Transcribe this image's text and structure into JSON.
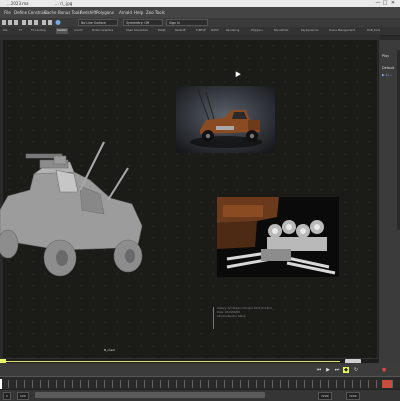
{
  "window": {
    "app_title": "...2023.ma",
    "file_name": "... rl_.jpg",
    "minimize_glyph": "—",
    "maximize_glyph": "□",
    "close_glyph": "✕"
  },
  "menubar": {
    "items": [
      "File",
      "Define",
      "Constrain",
      "Cache",
      "Bonus Tools",
      "Redshift",
      "Polygons",
      "Arnold",
      "Help",
      "Zoo Tools"
    ]
  },
  "toolbar": {
    "live_surface": "No Live Surface",
    "symmetry": "Symmetry: Off",
    "sign_in": "Sign In"
  },
  "shelf": {
    "tabs": [
      "File",
      "FX",
      "FX Caching",
      "Custom",
      "Arnold",
      "Motion Graphics",
      "XGen Interactive",
      "Bullet",
      "Redshift",
      "TURTLE",
      "MASH",
      "Rendering",
      "Polygons",
      "BonusTools",
      "KeyDynamics",
      "Scene Management",
      "DAB_tools"
    ],
    "active_index": 3
  },
  "right_panel": {
    "title": "Play",
    "layer": "Default",
    "item": "▶ Li..."
  },
  "viewport": {
    "frame_label": "B_mark",
    "note_lines": [
      "Gallery: Art Station Monster 2023 Hot Rod",
      "Date: 2023/06/08",
      "Cinema/Render Setup"
    ]
  },
  "statusbar": {
    "icons": [
      "rewind-icon",
      "play-icon",
      "forward-icon",
      "key-icon",
      "loop-icon",
      "record-icon"
    ]
  },
  "rangebar": {
    "start": "1",
    "end": "120",
    "range_end": "7200",
    "fps": "7200"
  },
  "colors": {
    "accent_yellow": "#e9f564",
    "viewport_bg": "#1b1c18",
    "panel_bg": "#3b3b3b",
    "key_red": "#c94b3a"
  }
}
